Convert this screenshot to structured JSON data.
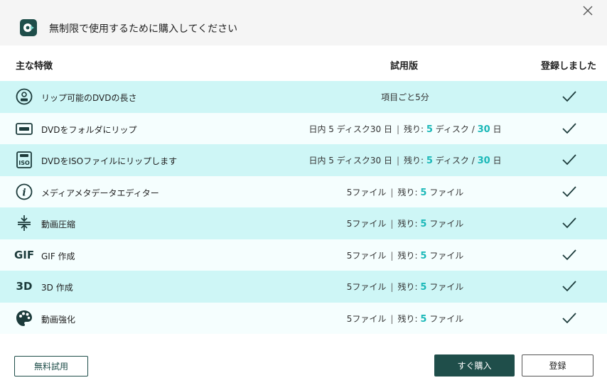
{
  "window": {
    "title": "無制限で使用するために購入してください"
  },
  "header": {
    "feature": "主な特徴",
    "trial": "試用版",
    "registered": "登録しました"
  },
  "rows": [
    {
      "icon": "dvd-disc-icon",
      "label": "リップ可能のDVDの長さ",
      "trial": {
        "type": "plain",
        "text": "項目ごと5分"
      }
    },
    {
      "icon": "dvd-folder-icon",
      "label": "DVDをフォルダにリップ",
      "trial": {
        "type": "disc",
        "prefix": "日内 5 ディスク30 日",
        "remain_label": "残り:",
        "remain_count": "5",
        "unit1": "ディスク /",
        "remain_days": "30",
        "unit2": "日"
      }
    },
    {
      "icon": "dvd-iso-icon",
      "label": "DVDをISOファイルにリップします",
      "trial": {
        "type": "disc",
        "prefix": "日内 5 ディスク30 日",
        "remain_label": "残り:",
        "remain_count": "5",
        "unit1": "ディスク /",
        "remain_days": "30",
        "unit2": "日"
      }
    },
    {
      "icon": "info-icon",
      "label": "メディアメタデータエディター",
      "trial": {
        "type": "file",
        "prefix": "5ファイル",
        "remain_label": "残り:",
        "remain_count": "5",
        "unit": "ファイル"
      }
    },
    {
      "icon": "compress-icon",
      "label": "動画圧縮",
      "trial": {
        "type": "file",
        "prefix": "5ファイル",
        "remain_label": "残り:",
        "remain_count": "5",
        "unit": "ファイル"
      }
    },
    {
      "icon": "gif-icon",
      "icon_text": "GIF",
      "label": "GIF 作成",
      "trial": {
        "type": "file",
        "prefix": "5ファイル",
        "remain_label": "残り:",
        "remain_count": "5",
        "unit": "ファイル"
      }
    },
    {
      "icon": "3d-icon",
      "icon_text": "3D",
      "label": "3D 作成",
      "trial": {
        "type": "file",
        "prefix": "5ファイル",
        "remain_label": "残り:",
        "remain_count": "5",
        "unit": "ファイル"
      }
    },
    {
      "icon": "palette-icon",
      "label": "動画強化",
      "trial": {
        "type": "file",
        "prefix": "5ファイル",
        "remain_label": "残り:",
        "remain_count": "5",
        "unit": "ファイル"
      }
    }
  ],
  "buttons": {
    "free_trial": "無料試用",
    "buy_now": "すぐ購入",
    "register": "登録"
  },
  "colors": {
    "brand": "#1f4e4a",
    "highlight": "#1bb8b8",
    "row_alt": "#cef6f6"
  }
}
